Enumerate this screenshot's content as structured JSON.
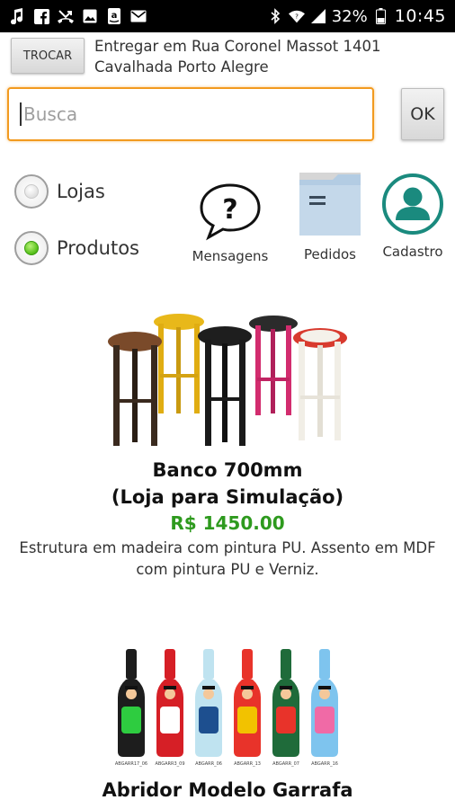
{
  "status_bar": {
    "battery": "32%",
    "time": "10:45",
    "icons": [
      "music-note-icon",
      "facebook-icon",
      "missed-call-icon",
      "image-icon",
      "amazon-icon",
      "mail-icon",
      "bluetooth-icon",
      "wifi-icon",
      "signal-icon",
      "battery-icon"
    ]
  },
  "address": {
    "change_label": "TROCAR",
    "line1": "Entregar em Rua Coronel Massot 1401",
    "line2": "Cavalhada Porto Alegre"
  },
  "search": {
    "placeholder": "Busca",
    "value": "",
    "ok_label": "OK",
    "focus_color": "#f29a1f"
  },
  "mode": {
    "options": [
      {
        "label": "Lojas",
        "checked": false
      },
      {
        "label": "Produtos",
        "checked": true
      }
    ]
  },
  "actions": [
    {
      "icon": "question-bubble-icon",
      "label": "Mensagens"
    },
    {
      "icon": "folder-icon",
      "label": "Pedidos"
    },
    {
      "icon": "user-circle-icon",
      "label": "Cadastro"
    }
  ],
  "products": [
    {
      "image": "stools-image",
      "name_line1": "Banco 700mm",
      "name_line2": "(Loja para Simulação)",
      "price": "R$ 1450.00",
      "description": "Estrutura em madeira com pintura PU. Assento em MDF com pintura PU e Verniz."
    },
    {
      "image": "bottle-openers-image",
      "name_line1": "Abridor Modelo Garrafa",
      "bottle_captions": [
        "ABGARR17_06",
        "ABGARR3_09",
        "ABGARR_06",
        "ABGARR_13",
        "ABGARR_07",
        "ABGARR_16"
      ]
    }
  ],
  "colors": {
    "price_green": "#2e9a1e",
    "teal": "#1a8a7e"
  }
}
